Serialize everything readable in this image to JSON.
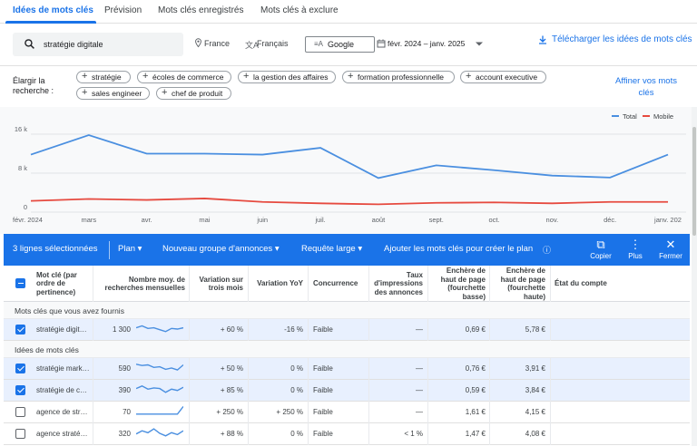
{
  "tabs": [
    {
      "label": "Idées de mots clés",
      "active": true
    },
    {
      "label": "Prévision"
    },
    {
      "label": "Mots clés enregistrés"
    },
    {
      "label": "Mots clés à exclure"
    }
  ],
  "search": {
    "query": "stratégie digitale",
    "location": "France",
    "language": "Français",
    "network": "Google",
    "date_range": "févr. 2024 – janv. 2025",
    "download_label": "Télécharger les idées de mots clés"
  },
  "broaden": {
    "label": "Élargir la recherche :",
    "chips": [
      "stratégie",
      "écoles de commerce",
      "la gestion des affaires",
      "formation professionnelle",
      "account executive",
      "sales engineer",
      "chef de produit"
    ],
    "refine_label": "Affiner vos mots clés"
  },
  "chart_data": {
    "type": "line",
    "x": [
      "févr. 2024",
      "mars",
      "avr.",
      "mai",
      "juin",
      "juil.",
      "août",
      "sept.",
      "oct.",
      "nov.",
      "déc.",
      "janv. 202"
    ],
    "series": [
      {
        "name": "Total",
        "color": "#4a8fe0",
        "values": [
          11800,
          15800,
          12000,
          12000,
          11800,
          13200,
          7000,
          9600,
          8600,
          7500,
          7100,
          11800
        ]
      },
      {
        "name": "Mobile",
        "color": "#e64a3f",
        "values": [
          2300,
          2700,
          2500,
          2800,
          2100,
          1800,
          1600,
          1900,
          2000,
          1800,
          2100,
          2100
        ]
      }
    ],
    "y_ticks": [
      "16 k",
      "8 k",
      "0"
    ],
    "ylim": [
      0,
      16000
    ],
    "legend_position": "top-right",
    "grid": true
  },
  "selection_bar": {
    "count_label": "3 lignes sélectionnées",
    "plan": "Plan",
    "new_group": "Nouveau groupe d'annonces",
    "match": "Requête large",
    "add_label": "Ajouter les mots clés pour créer le plan",
    "copy": "Copier",
    "more": "Plus",
    "close": "Fermer"
  },
  "table": {
    "headers": {
      "keyword": "Mot clé (par ordre de pertinence)",
      "volume": "Nombre moy. de recherches mensuelles",
      "three_month": "Variation sur trois mois",
      "yoy": "Variation YoY",
      "competition": "Concurrence",
      "impression_share": "Taux d'impressions des annonces",
      "bid_low": "Enchère de haut de page (fourchette basse)",
      "bid_high": "Enchère de haut de page (fourchette haute)",
      "account_status": "État du compte"
    },
    "group_provided": "Mots clés que vous avez fournis",
    "group_ideas": "Idées de mots clés",
    "provided_rows": [
      {
        "keyword": "stratégie digit…",
        "volume": "1 300",
        "three_month": "+ 60 %",
        "yoy": "-16 %",
        "competition": "Faible",
        "impression": "—",
        "bid_low": "0,69 €",
        "bid_high": "5,78 €",
        "selected": true,
        "spark": [
          0.6,
          0.75,
          0.55,
          0.6,
          0.45,
          0.3,
          0.55,
          0.5,
          0.6
        ]
      }
    ],
    "idea_rows": [
      {
        "keyword": "stratégie mark…",
        "volume": "590",
        "three_month": "+ 50 %",
        "yoy": "0 %",
        "competition": "Faible",
        "impression": "—",
        "bid_low": "0,76 €",
        "bid_high": "3,91 €",
        "selected": true,
        "spark": [
          0.8,
          0.7,
          0.75,
          0.55,
          0.6,
          0.4,
          0.5,
          0.35,
          0.75
        ]
      },
      {
        "keyword": "stratégie de c…",
        "volume": "390",
        "three_month": "+ 85 %",
        "yoy": "0 %",
        "competition": "Faible",
        "impression": "—",
        "bid_low": "0,59 €",
        "bid_high": "3,84 €",
        "selected": true,
        "spark": [
          0.6,
          0.8,
          0.55,
          0.65,
          0.6,
          0.3,
          0.55,
          0.45,
          0.7
        ]
      },
      {
        "keyword": "agence de str…",
        "volume": "70",
        "three_month": "+ 250 %",
        "yoy": "+ 250 %",
        "competition": "Faible",
        "impression": "—",
        "bid_low": "1,61 €",
        "bid_high": "4,15 €",
        "selected": false,
        "spark": [
          0.3,
          0.3,
          0.3,
          0.3,
          0.3,
          0.3,
          0.3,
          0.3,
          0.9
        ]
      },
      {
        "keyword": "agence straté…",
        "volume": "320",
        "three_month": "+ 88 %",
        "yoy": "0 %",
        "competition": "Faible",
        "impression": "< 1 %",
        "bid_low": "1,47 €",
        "bid_high": "4,08 €",
        "selected": false,
        "spark": [
          0.45,
          0.7,
          0.55,
          0.85,
          0.5,
          0.3,
          0.55,
          0.4,
          0.7
        ]
      }
    ]
  }
}
